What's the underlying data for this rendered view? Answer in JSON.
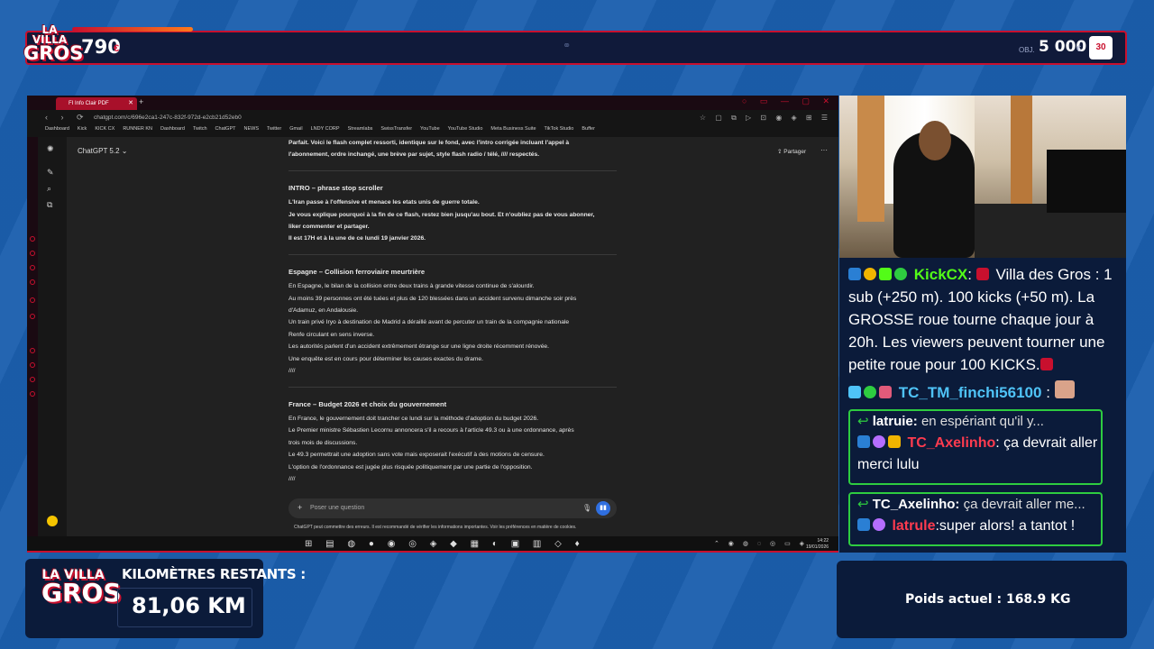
{
  "top_bar": {
    "logo_line1": "LA VILLA",
    "logo_line2": "GROS",
    "count": "790",
    "count_unit": "€",
    "mid_icon": "link-icon",
    "objective_label": "OBJ.",
    "objective_value": "5 000",
    "objective_unit": "€",
    "badge": "30",
    "progress_fraction": 0.11
  },
  "browser": {
    "tab_title": "FI Info Clair PDF",
    "url": "chatgpt.com/c/696e2ca1-247c-832f-972d-e2cb21d52eb0",
    "bookmarks": [
      "Dashboard",
      "Kick",
      "KICK CX",
      "RUNNER KN",
      "Dashboard",
      "Twitch",
      "ChatGPT",
      "NEWS",
      "Twitter",
      "Gmail",
      "LNDY CORP",
      "Streamlabs",
      "SwissTransfer",
      "YouTube",
      "YouTube Studio",
      "Meta Business Suite",
      "TikTok Studio",
      "Buffer"
    ]
  },
  "chatgpt": {
    "model": "ChatGPT 5.2 ⌄",
    "share": "⇪ Partager",
    "intro_line1": "Parfait. Voici le flash complet ressorti, identique sur le fond, avec l'intro corrigée incluant l'appel à",
    "intro_line2": "l'abonnement, ordre inchangé, une brève par sujet, style flash radio / télé, //// respectés.",
    "sections": [
      {
        "title": "INTRO – phrase stop scroller",
        "lines": [
          "L'Iran passe à l'offensive et menace les etats unis de guerre totale.",
          "Je vous explique pourquoi à la fin de ce flash, restez bien jusqu'au bout. Et n'oubliez pas de vous abonner,",
          "liker commenter et partager.",
          "Il est 17H et à la une de ce lundi 19 janvier 2026."
        ]
      },
      {
        "title": "Espagne – Collision ferroviaire meurtrière",
        "lines": [
          "En Espagne, le bilan de la collision entre deux trains à grande vitesse continue de s'alourdir.",
          "Au moins 39 personnes ont été tuées et plus de 120 blessées dans un accident survenu dimanche soir près",
          "d'Adamuz, en Andalousie.",
          "Un train privé Iryo à destination de Madrid a déraillé avant de percuter un train de la compagnie nationale",
          "Renfe circulant en sens inverse.",
          "Les autorités parlent d'un accident extrêmement étrange sur une ligne droite récemment rénovée.",
          "Une enquête est en cours pour déterminer les causes exactes du drame.",
          "////"
        ]
      },
      {
        "title": "France – Budget 2026 et choix du gouvernement",
        "lines": [
          "En France, le gouvernement doit trancher ce lundi sur la méthode d'adoption du budget 2026.",
          "Le Premier ministre Sébastien Lecornu annoncera s'il a recours à l'article 49.3 ou à une ordonnance, après",
          "trois mois de discussions.",
          "Le 49.3 permettrait une adoption sans vote mais exposerait l'exécutif à des motions de censure.",
          "L'option de l'ordonnance est jugée plus risquée politiquement par une partie de l'opposition.",
          "////"
        ]
      }
    ],
    "composer_placeholder": "Poser une question",
    "disclaimer": "ChatGPT peut commettre des erreurs. Il est recommandé de vérifier les informations importantes. Voir les préférences en matière de cookies."
  },
  "taskbar": {
    "time": "14:22",
    "date": "19/01/2026"
  },
  "stream_chat": {
    "msg1_user": "KickCX",
    "msg1_text": "Villa des Gros : 1 sub (+250 m). 100 kicks (+50 m). La GROSSE roue tourne chaque jour à 20h. Les viewers peuvent tourner une petite roue pour 100 KICKS.",
    "msg2_user": "TC_TM_finchi56100",
    "reply1_to_user": "latruie:",
    "reply1_ref_text": "en espériant qu'il y...",
    "reply1_user": "TC_Axelinho",
    "reply1_text": "ça devrait aller merci lulu",
    "reply2_to_user": "TC_Axelinho:",
    "reply2_ref_text": "ça devrait aller me...",
    "reply2_user": "latrule",
    "reply2_text": "super alors! a tantot !",
    "colors": {
      "kick_green": "#53fc18",
      "cyan": "#4fc3f7",
      "red_user": "#ff3b4f",
      "reply_border": "#2ecc40"
    }
  },
  "km_panel": {
    "logo_line1": "LA VILLA",
    "logo_line2": "GROS",
    "title": "KILOMÈTRES RESTANTS :",
    "value": "81,06 KM"
  },
  "poids_panel": {
    "text": "Poids actuel : 168.9 KG"
  }
}
